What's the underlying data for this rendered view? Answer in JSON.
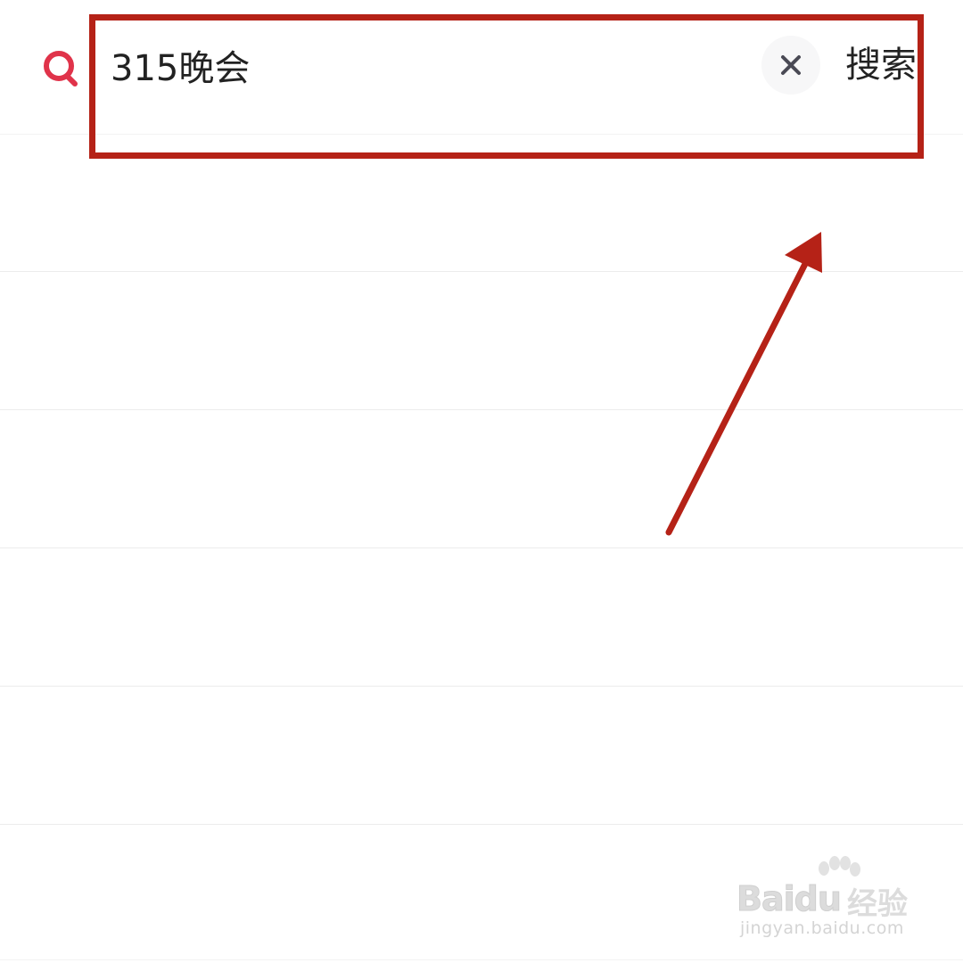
{
  "search": {
    "query": "315晚会",
    "submit_label": "搜索",
    "clear_icon": "close-icon",
    "search_icon": "search-icon",
    "accent_color": "#e0334a"
  },
  "annotation": {
    "highlight_color": "#b52217",
    "arrow_color": "#b52217"
  },
  "watermark": {
    "logo_text": "Bai",
    "logo_text2": "du",
    "product": "经验",
    "url": "jingyan.baidu.com"
  }
}
